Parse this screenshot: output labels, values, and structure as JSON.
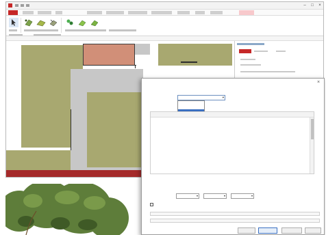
{
  "app": {
    "title": "",
    "file_tab": "",
    "ribbon_highlight_tab": ""
  },
  "canvas": {
    "rooms": [
      {
        "label": ""
      },
      {
        "label": ""
      },
      {
        "label": ""
      },
      {
        "label": ""
      },
      {
        "label": ""
      },
      {
        "label": ""
      }
    ],
    "dims": [
      "",
      "",
      ""
    ]
  },
  "dialog": {
    "title": "",
    "name_label": "",
    "combo_value": "",
    "dropdown_options": [
      "",
      "",
      "",
      ""
    ],
    "dropdown_selected_index": 2,
    "table_caption": "",
    "table_headers": [
      "",
      "",
      "",
      ""
    ],
    "table_rows": [
      [
        "",
        "",
        "",
        ""
      ],
      [
        "",
        "",
        "",
        ""
      ],
      [
        "",
        "",
        "",
        ""
      ],
      [
        "",
        "",
        "",
        ""
      ],
      [
        "",
        "",
        "",
        ""
      ],
      [
        "",
        "",
        "",
        ""
      ],
      [
        "",
        "",
        "",
        ""
      ],
      [
        "",
        "",
        "",
        ""
      ],
      [
        "",
        "",
        "",
        ""
      ],
      [
        "",
        "",
        "",
        ""
      ],
      [
        "",
        "",
        "",
        ""
      ],
      [
        "",
        "",
        "",
        ""
      ]
    ],
    "section_label": "",
    "col_labels": [
      "",
      "",
      ""
    ],
    "row_label": "",
    "selects": [
      "",
      "",
      ""
    ],
    "checkbox_label": "",
    "buttons": [
      "",
      "",
      "",
      ""
    ]
  },
  "colors": {
    "accent": "#c62828",
    "olive_room": "#a8a870",
    "highlight_room": "#d18f78",
    "selection": "#3a6fc1"
  }
}
